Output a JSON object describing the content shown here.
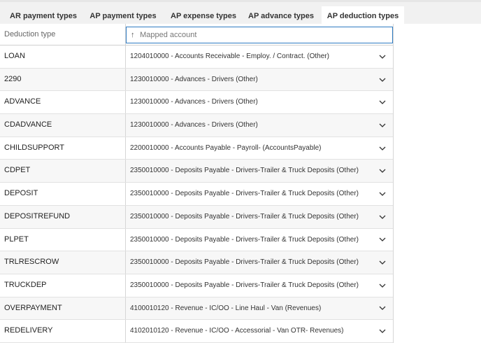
{
  "tabs": [
    {
      "label": "AR payment types"
    },
    {
      "label": "AP payment types"
    },
    {
      "label": "AP expense types"
    },
    {
      "label": "AP advance types"
    },
    {
      "label": "AP deduction types",
      "active": true
    }
  ],
  "grid": {
    "col_type_header": "Deduction type",
    "col_account_placeholder": "Mapped account",
    "rows": [
      {
        "type": "LOAN",
        "account": "1204010000 - Accounts Receivable - Employ. / Contract. (Other)"
      },
      {
        "type": "2290",
        "account": "1230010000 - Advances - Drivers (Other)"
      },
      {
        "type": "ADVANCE",
        "account": "1230010000 - Advances - Drivers (Other)"
      },
      {
        "type": "CDADVANCE",
        "account": "1230010000 - Advances - Drivers (Other)"
      },
      {
        "type": "CHILDSUPPORT",
        "account": "2200010000 - Accounts Payable - Payroll- (AccountsPayable)"
      },
      {
        "type": "CDPET",
        "account": "2350010000 - Deposits Payable - Drivers-Trailer & Truck Deposits (Other)"
      },
      {
        "type": "DEPOSIT",
        "account": "2350010000 - Deposits Payable - Drivers-Trailer & Truck Deposits (Other)"
      },
      {
        "type": "DEPOSITREFUND",
        "account": "2350010000 - Deposits Payable - Drivers-Trailer & Truck Deposits (Other)"
      },
      {
        "type": "PLPET",
        "account": "2350010000 - Deposits Payable - Drivers-Trailer & Truck Deposits (Other)"
      },
      {
        "type": "TRLRESCROW",
        "account": "2350010000 - Deposits Payable - Drivers-Trailer & Truck Deposits (Other)"
      },
      {
        "type": "TRUCKDEP",
        "account": "2350010000 - Deposits Payable - Drivers-Trailer & Truck Deposits (Other)"
      },
      {
        "type": "OVERPAYMENT",
        "account": "4100010120 - Revenue - IC/OO - Line Haul - Van (Revenues)"
      },
      {
        "type": "REDELIVERY",
        "account": "4102010120 - Revenue - IC/OO - Accessorial - Van OTR- Revenues)"
      }
    ]
  }
}
